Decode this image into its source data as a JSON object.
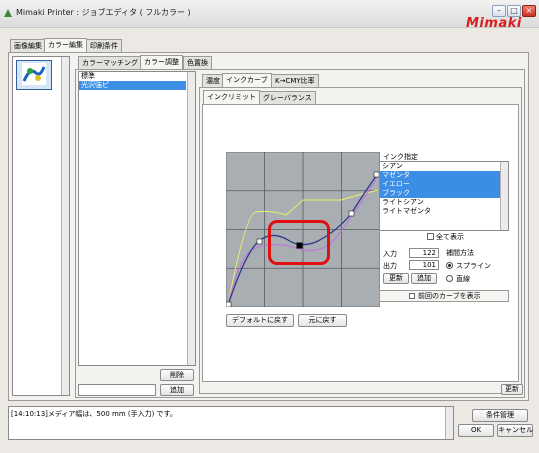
{
  "window": {
    "title": "Mimaki Printer : ジョブエディタ ( フルカラー )",
    "brand": "Mimaki"
  },
  "main_tabs": [
    "画像編集",
    "カラー編集",
    "印刷条件"
  ],
  "color_tabs": [
    "カラーマッチング",
    "カラー調整",
    "色置換"
  ],
  "profile_list": {
    "items": [
      "標準",
      "光沢強ピ"
    ],
    "selected_index": 1,
    "delete_label": "削除",
    "add_label": "追加"
  },
  "adjust_tabs": [
    "濃度",
    "インクカーブ",
    "K→CMY比率"
  ],
  "curve_tabs": [
    "インクリミット",
    "グレーバランス"
  ],
  "ink_panel": {
    "header": "インク指定",
    "items": [
      "シアン",
      "マゼンタ",
      "イエロー",
      "ブラック",
      "ライトシアン",
      "ライトマゼンタ"
    ],
    "selected": [
      1,
      2,
      3
    ],
    "show_all_label": "全て表示",
    "input_label": "入力",
    "input_value": "122",
    "output_label": "出力",
    "output_value": "101",
    "interp_label": "補間方法",
    "spline_label": "スプライン",
    "linear_label": "直線",
    "update_label": "更新",
    "add_label": "追加",
    "prev_curve_label": "前回のカーブを表示"
  },
  "curve_buttons": {
    "default_label": "デフォルトに戻す",
    "revert_label": "元に戻す"
  },
  "update_button": "更新",
  "status": {
    "message": "[14:10:13]メディア幅は、500 mm (手入力) です。"
  },
  "footer": {
    "condition_label": "条件管理",
    "ok_label": "OK",
    "cancel_label": "キャンセル"
  },
  "colors": {
    "selection": "#3b8ee4",
    "brand": "#d81e1e",
    "highlight_ring": "#e01010"
  },
  "curve_data": {
    "x_range": [
      0,
      255
    ],
    "y_range": [
      0,
      255
    ],
    "control_point": {
      "input": 122,
      "output": 101
    }
  }
}
